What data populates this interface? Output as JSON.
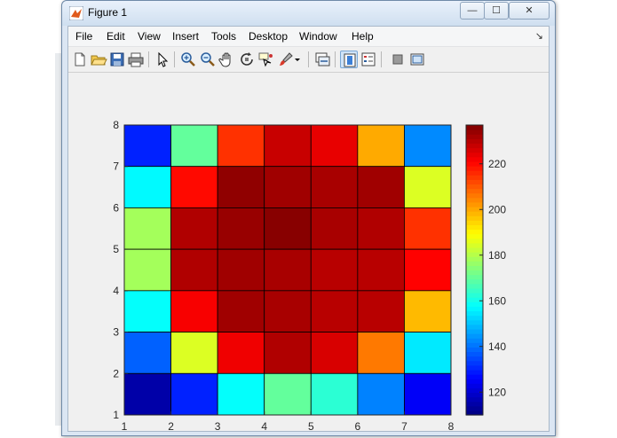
{
  "window": {
    "title": "Figure 1",
    "controls": {
      "minimize": "—",
      "maximize": "☐",
      "close": "✕"
    }
  },
  "menu": {
    "items": [
      "File",
      "Edit",
      "View",
      "Insert",
      "Tools",
      "Desktop",
      "Window",
      "Help"
    ],
    "overflow_icon": "chevron-arrow-icon"
  },
  "toolbar": {
    "buttons": [
      "new-figure-icon",
      "open-file-icon",
      "save-icon",
      "print-icon",
      "edit-plot-arrow-icon",
      "zoom-in-icon",
      "zoom-out-icon",
      "pan-hand-icon",
      "rotate-3d-icon",
      "data-cursor-icon",
      "brush-icon",
      "brush-dropdown-icon",
      "link-plot-icon",
      "insert-colorbar-icon",
      "insert-legend-icon",
      "hide-plot-tools-icon",
      "show-plot-tools-icon"
    ]
  },
  "chart_data": {
    "type": "heatmap",
    "colormap": "jet",
    "x_ticks": [
      "1",
      "2",
      "3",
      "4",
      "5",
      "6",
      "7",
      "8"
    ],
    "y_ticks": [
      "1",
      "2",
      "3",
      "4",
      "5",
      "6",
      "7",
      "8"
    ],
    "xlim": [
      1,
      8
    ],
    "ylim": [
      1,
      8
    ],
    "color_range": [
      110,
      237
    ],
    "colorbar_ticks": [
      "120",
      "140",
      "160",
      "180",
      "200",
      "220"
    ],
    "colorbar_tick_values": [
      120,
      140,
      160,
      180,
      200,
      220
    ],
    "rows_top_to_bottom": [
      [
        130,
        170,
        215,
        228,
        224,
        200,
        143
      ],
      [
        157,
        220,
        235,
        233,
        232,
        233,
        185
      ],
      [
        178,
        231,
        234,
        236,
        232,
        231,
        215
      ],
      [
        178,
        231,
        233,
        232,
        230,
        230,
        221
      ],
      [
        158,
        222,
        233,
        232,
        230,
        230,
        198
      ],
      [
        138,
        185,
        223,
        231,
        226,
        206,
        155
      ],
      [
        115,
        130,
        158,
        170,
        163,
        142,
        125
      ]
    ]
  }
}
